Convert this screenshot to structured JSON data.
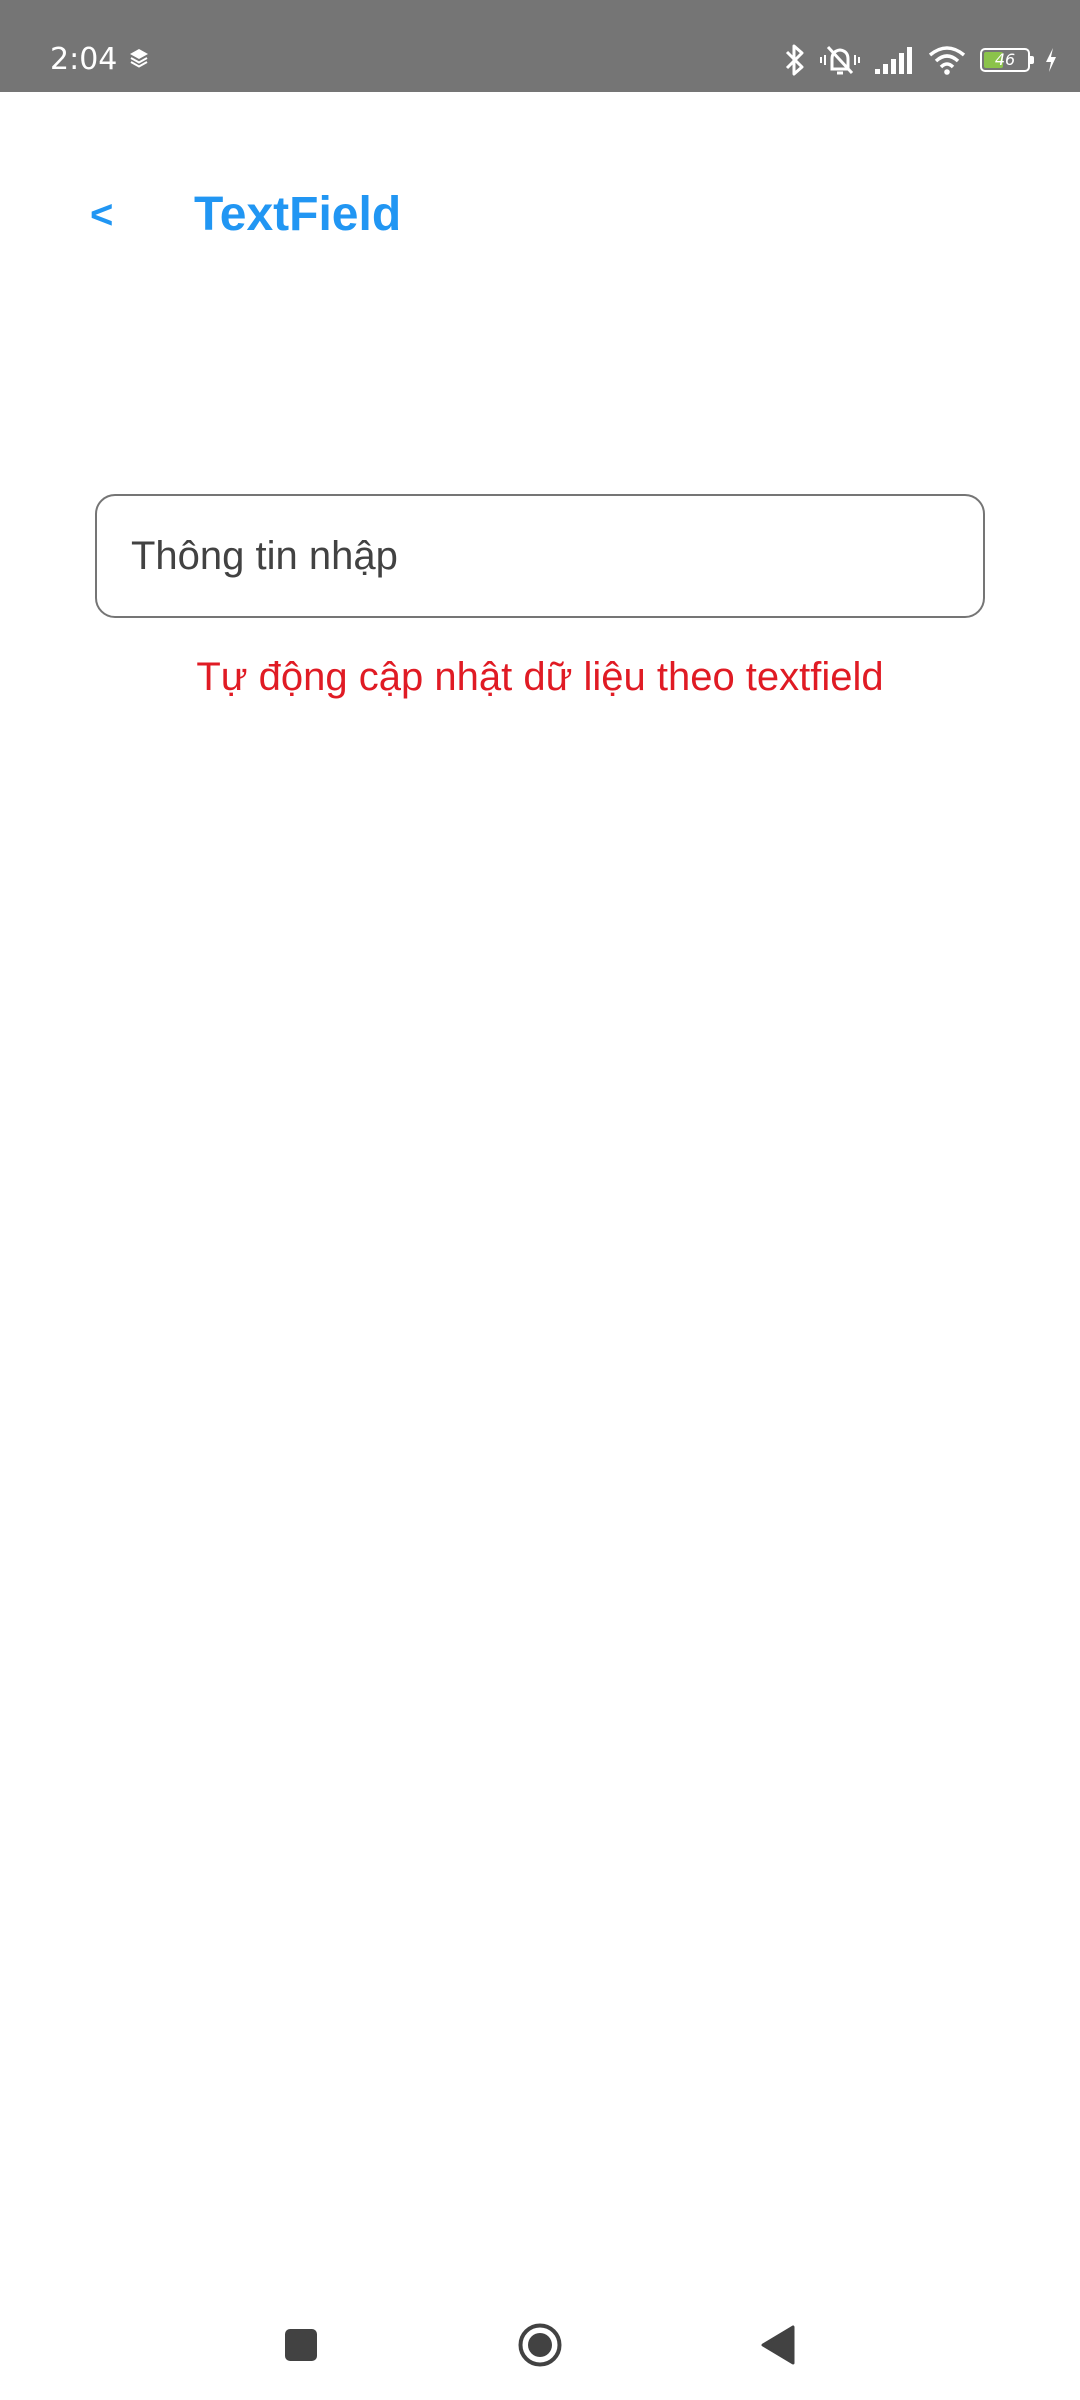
{
  "status_bar": {
    "time": "2:04",
    "battery_level": "46",
    "battery_fraction": 0.46,
    "icons": [
      "layers-icon",
      "bluetooth-icon",
      "mute-vibrate-icon",
      "signal-icon",
      "wifi-icon",
      "battery-icon",
      "charging-icon"
    ],
    "background_color": "#757575"
  },
  "app_bar": {
    "back_label": "<",
    "title": "TextField",
    "accent_color": "#2196f3"
  },
  "form": {
    "input_value": "",
    "input_placeholder": "Thông tin nhập",
    "auto_update_text": "Tự động cập nhật dữ liệu theo textfield",
    "auto_update_color": "#e01b24"
  },
  "nav_bar": {
    "icons": [
      "recents-square-icon",
      "home-circle-icon",
      "back-triangle-icon"
    ]
  }
}
